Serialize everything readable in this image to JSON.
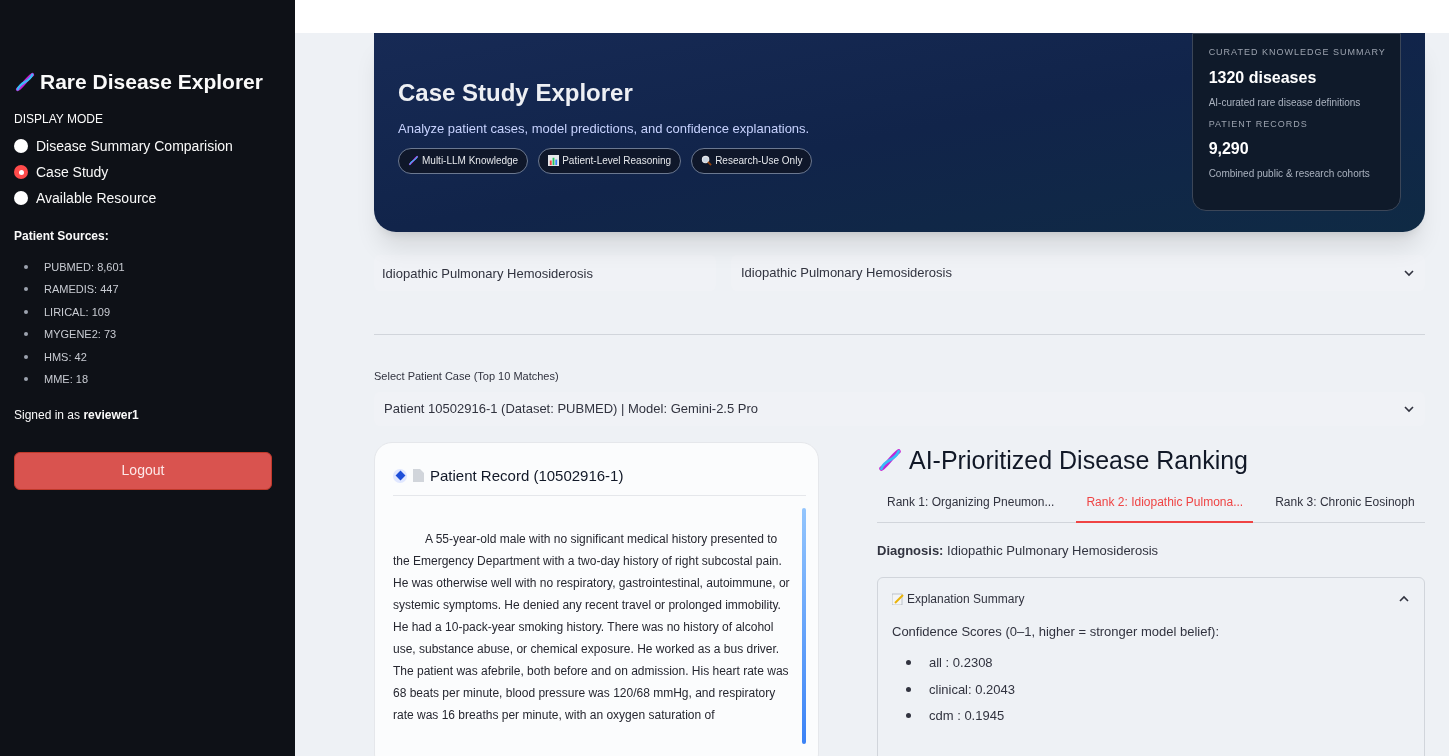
{
  "sidebar": {
    "title": "Rare Disease Explorer",
    "display_mode_label": "DISPLAY MODE",
    "modes": [
      {
        "label": "Disease Summary Comparision",
        "selected": false
      },
      {
        "label": "Case Study",
        "selected": true
      },
      {
        "label": "Available Resource",
        "selected": false
      }
    ],
    "sources_heading": "Patient Sources:",
    "sources": [
      "PUBMED: 8,601",
      "RAMEDIS: 447",
      "LIRICAL: 109",
      "MYGENE2: 73",
      "HMS: 42",
      "MME: 18"
    ],
    "signed_in": "Signed in as **reviewer1**",
    "logout": "Logout"
  },
  "hero": {
    "title": "Case Study Explorer",
    "subtitle": "Analyze patient cases, model predictions, and confidence explanations.",
    "chips": [
      "Multi-LLM Knowledge",
      "Patient-Level Reasoning",
      "Research-Use Only"
    ],
    "summary": [
      {
        "label": "CURATED KNOWLEDGE SUMMARY",
        "value": "1320 diseases",
        "note": "AI-curated rare disease definitions"
      },
      {
        "label": "PATIENT RECORDS",
        "value": "9,290",
        "note": "Combined public & research cohorts"
      }
    ]
  },
  "disease_search": {
    "value": "Idiopathic Pulmonary Hemosiderosis"
  },
  "disease_select": {
    "value": "Idiopathic Pulmonary Hemosiderosis"
  },
  "patient_case": {
    "label": "Select Patient Case (Top 10 Matches)",
    "value": "Patient 10502916-1 (Dataset: PUBMED) | Model: Gemini-2.5 Pro"
  },
  "record": {
    "title": "Patient Record (10502916-1)",
    "paragraphs": [
      "A 55-year-old male with no significant medical history presented to the Emergency Department with a two-day history of right subcostal pain. He was otherwise well with no respiratory, gastrointestinal, autoimmune, or systemic symptoms. He denied any recent travel or prolonged immobility. He had a 10-pack-year smoking history. There was no history of alcohol use, substance abuse, or chemical exposure. He worked as a bus driver.",
      "The patient was afebrile, both before and on admission. His heart rate was 68 beats per minute, blood pressure was 120/68 mmHg, and respiratory rate was 16 breaths per minute, with an oxygen saturation of"
    ]
  },
  "ranking": {
    "title": "AI-Prioritized Disease Ranking",
    "tabs": [
      {
        "label": "Rank 1: Organizing Pneumon...",
        "selected": false
      },
      {
        "label": "Rank 2: Idiopathic Pulmona...",
        "selected": true
      },
      {
        "label": "Rank 3: Chronic Eosinoph",
        "selected": false
      }
    ],
    "diagnosis": "**Diagnosis:** Idiopathic Pulmonary Hemosiderosis",
    "explanation": {
      "title": "Explanation Summary",
      "expanded": true,
      "intro": "Confidence Scores (0–1, higher = stronger model belief):",
      "scores": [
        "all : 0.2308",
        "clinical: 0.2043",
        "cdm : 0.1945"
      ]
    }
  }
}
